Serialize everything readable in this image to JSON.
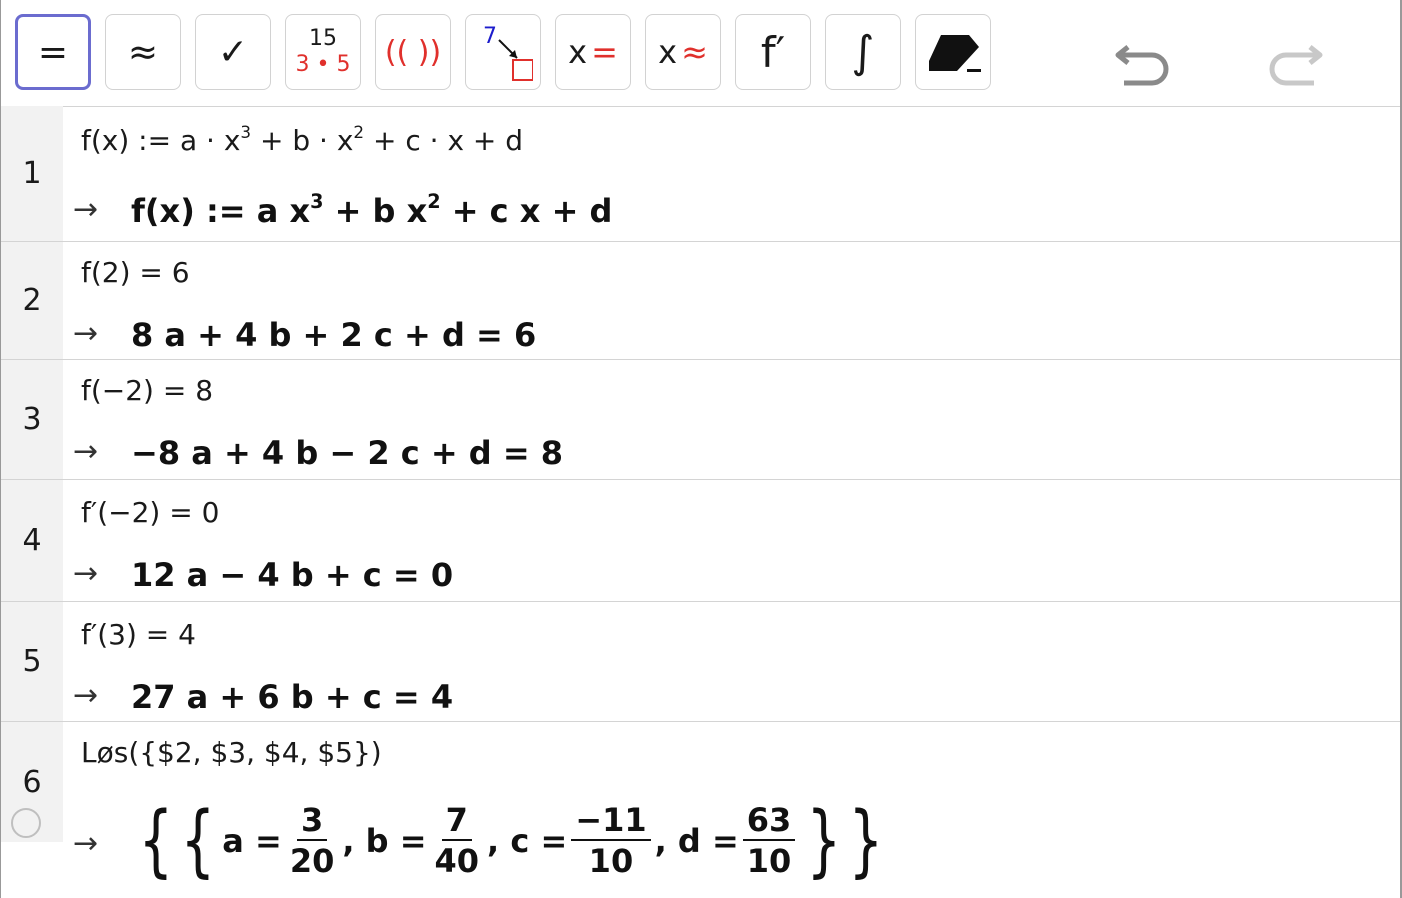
{
  "toolbar": {
    "tools": [
      {
        "name": "evaluate",
        "label": "="
      },
      {
        "name": "numeric",
        "label": "≈"
      },
      {
        "name": "keep-input",
        "label": "✓"
      },
      {
        "name": "factor",
        "label_top": "15",
        "label_bottom": "3 • 5"
      },
      {
        "name": "expand",
        "label": "(( ))"
      },
      {
        "name": "substitute",
        "label": "7"
      },
      {
        "name": "solve",
        "label_x": "x",
        "label_op": "="
      },
      {
        "name": "solve-numerically",
        "label_x": "x",
        "label_op": "≈"
      },
      {
        "name": "derivative",
        "label": "f′"
      },
      {
        "name": "integral",
        "label": "∫"
      },
      {
        "name": "delete",
        "label": ""
      }
    ]
  },
  "rows": [
    {
      "n": "1",
      "input": "f(x) := a · x",
      "in_sup1": "3",
      "input_b": " + b · x",
      "in_sup2": "2",
      "input_c": " + c · x + d",
      "output": "f(x)  :=  a x",
      "out_sup1": "3",
      "output_b": " + b x",
      "out_sup2": "2",
      "output_c": " + c x + d"
    },
    {
      "n": "2",
      "input": "f(2)  =  6",
      "output": "8 a + 4 b + 2 c + d = 6"
    },
    {
      "n": "3",
      "input": "f(−2)  =  8",
      "output": "−8 a + 4 b − 2 c + d = 8"
    },
    {
      "n": "4",
      "input": "f′(−2)  =  0",
      "output": "12 a − 4 b + c = 0"
    },
    {
      "n": "5",
      "input": "f′(3)  =  4",
      "output": "27 a + 6 b + c = 4"
    },
    {
      "n": "6",
      "input": "Løs({$2,  $3,  $4,  $5})",
      "solution": {
        "a_lbl": "a =",
        "a_num": "3",
        "a_den": "20",
        "b_lbl": ", b =",
        "b_num": "7",
        "b_den": "40",
        "c_lbl": ", c =",
        "c_num": "−11",
        "c_den": "10",
        "d_lbl": ", d =",
        "d_num": "63",
        "d_den": "10"
      }
    }
  ],
  "arrow": "→",
  "colors": {
    "accent": "#6b6ccf",
    "red": "#e0302c",
    "blue": "#1c1ccc"
  }
}
